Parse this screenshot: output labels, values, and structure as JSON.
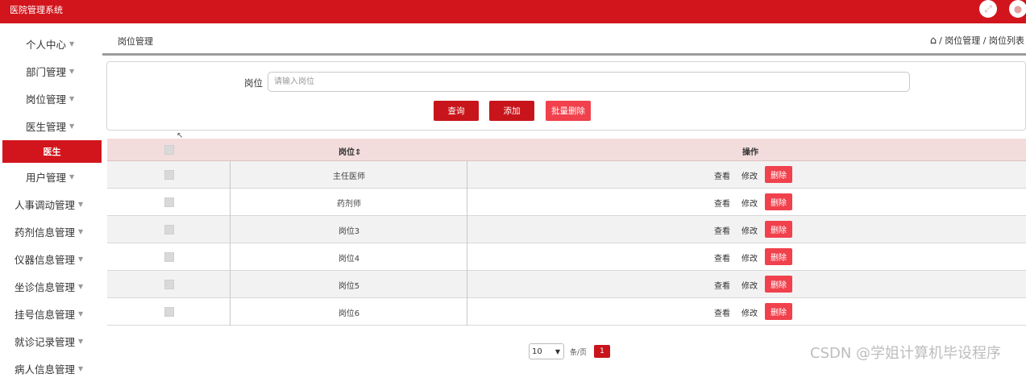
{
  "app": {
    "title": "医院管理系统"
  },
  "header": {
    "fullscreen_icon": "fullscreen-icon",
    "user_icon": "user-avatar-icon"
  },
  "sidebar": {
    "items": [
      {
        "label": "个人中心"
      },
      {
        "label": "部门管理"
      },
      {
        "label": "岗位管理"
      },
      {
        "label": "医生管理"
      },
      {
        "label": "用户管理"
      },
      {
        "label": "人事调动管理"
      },
      {
        "label": "药剂信息管理"
      },
      {
        "label": "仪器信息管理"
      },
      {
        "label": "坐诊信息管理"
      },
      {
        "label": "挂号信息管理"
      },
      {
        "label": "就诊记录管理"
      },
      {
        "label": "病人信息管理"
      }
    ],
    "active_sub": "医生"
  },
  "breadcrumb": {
    "title": "岗位管理",
    "path": "/ 岗位管理 / 岗位列表"
  },
  "search": {
    "label": "岗位",
    "placeholder": "请输入岗位",
    "query_label": "查询",
    "add_label": "添加",
    "batch_delete_label": "批量删除"
  },
  "table": {
    "headers": {
      "position": "岗位",
      "position_sort": "⇕",
      "actions": "操作"
    },
    "rows": [
      {
        "position": "主任医师"
      },
      {
        "position": "药剂师"
      },
      {
        "position": "岗位3"
      },
      {
        "position": "岗位4"
      },
      {
        "position": "岗位5"
      },
      {
        "position": "岗位6"
      }
    ],
    "actions": {
      "view": "查看",
      "edit": "修改",
      "delete": "删除"
    }
  },
  "pagination": {
    "page_size": "10",
    "per_page_label": "条/页",
    "current_page": "1"
  },
  "colors": {
    "brand": "#d2151c",
    "danger": "#f0414c",
    "header_bg": "#f3dcdc"
  },
  "watermark": "CSDN @学姐计算机毕设程序"
}
